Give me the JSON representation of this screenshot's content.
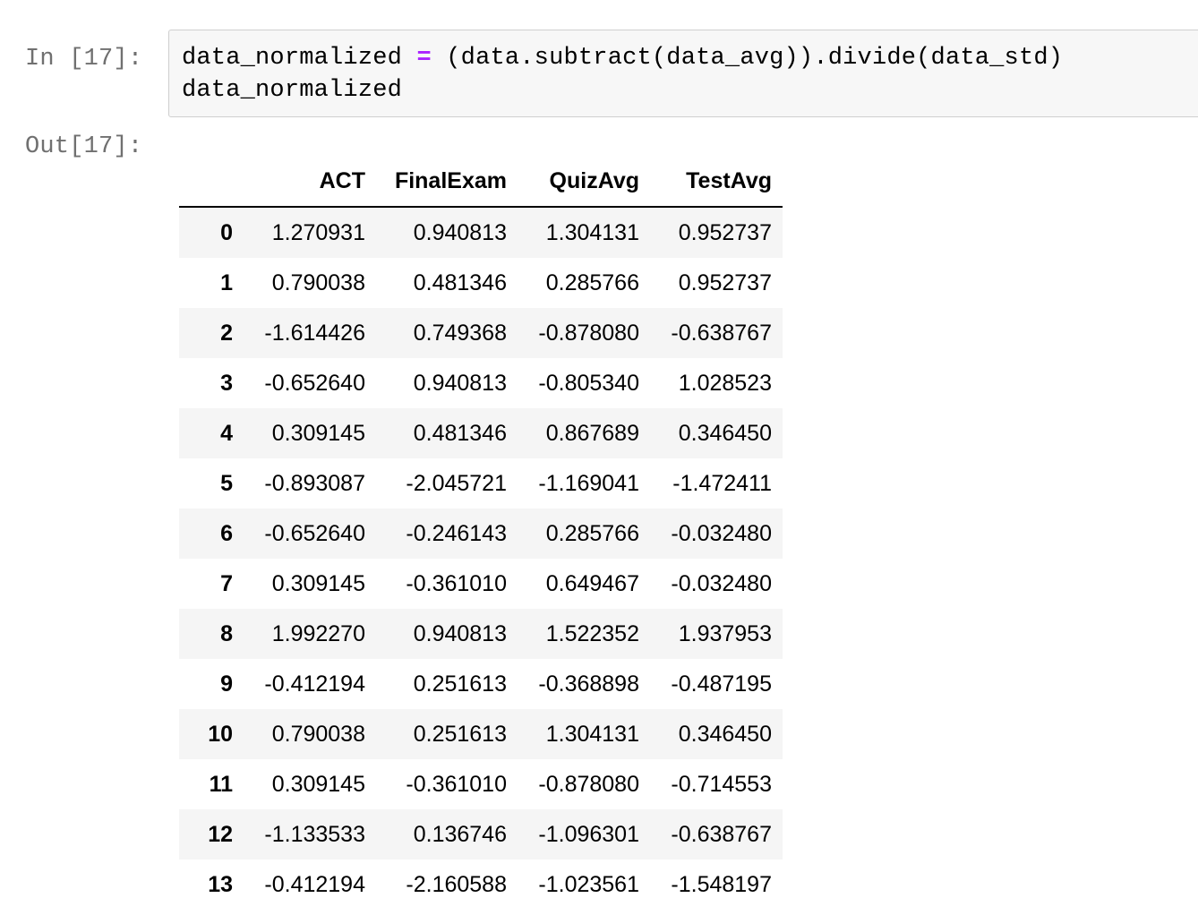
{
  "cells": {
    "input": {
      "prompt": "In [17]:",
      "code_line1_left": "data_normalized ",
      "code_line1_op": "=",
      "code_line1_right": " (data.subtract(data_avg)).divide(data_std)",
      "code_line2": "data_normalized"
    },
    "output": {
      "prompt": "Out[17]:"
    }
  },
  "table": {
    "columns": [
      "",
      "ACT",
      "FinalExam",
      "QuizAvg",
      "TestAvg"
    ],
    "rows": [
      {
        "index": "0",
        "ACT": "1.270931",
        "FinalExam": "0.940813",
        "QuizAvg": "1.304131",
        "TestAvg": "0.952737"
      },
      {
        "index": "1",
        "ACT": "0.790038",
        "FinalExam": "0.481346",
        "QuizAvg": "0.285766",
        "TestAvg": "0.952737"
      },
      {
        "index": "2",
        "ACT": "-1.614426",
        "FinalExam": "0.749368",
        "QuizAvg": "-0.878080",
        "TestAvg": "-0.638767"
      },
      {
        "index": "3",
        "ACT": "-0.652640",
        "FinalExam": "0.940813",
        "QuizAvg": "-0.805340",
        "TestAvg": "1.028523"
      },
      {
        "index": "4",
        "ACT": "0.309145",
        "FinalExam": "0.481346",
        "QuizAvg": "0.867689",
        "TestAvg": "0.346450"
      },
      {
        "index": "5",
        "ACT": "-0.893087",
        "FinalExam": "-2.045721",
        "QuizAvg": "-1.169041",
        "TestAvg": "-1.472411"
      },
      {
        "index": "6",
        "ACT": "-0.652640",
        "FinalExam": "-0.246143",
        "QuizAvg": "0.285766",
        "TestAvg": "-0.032480"
      },
      {
        "index": "7",
        "ACT": "0.309145",
        "FinalExam": "-0.361010",
        "QuizAvg": "0.649467",
        "TestAvg": "-0.032480"
      },
      {
        "index": "8",
        "ACT": "1.992270",
        "FinalExam": "0.940813",
        "QuizAvg": "1.522352",
        "TestAvg": "1.937953"
      },
      {
        "index": "9",
        "ACT": "-0.412194",
        "FinalExam": "0.251613",
        "QuizAvg": "-0.368898",
        "TestAvg": "-0.487195"
      },
      {
        "index": "10",
        "ACT": "0.790038",
        "FinalExam": "0.251613",
        "QuizAvg": "1.304131",
        "TestAvg": "0.346450"
      },
      {
        "index": "11",
        "ACT": "0.309145",
        "FinalExam": "-0.361010",
        "QuizAvg": "-0.878080",
        "TestAvg": "-0.714553"
      },
      {
        "index": "12",
        "ACT": "-1.133533",
        "FinalExam": "0.136746",
        "QuizAvg": "-1.096301",
        "TestAvg": "-0.638767"
      },
      {
        "index": "13",
        "ACT": "-0.412194",
        "FinalExam": "-2.160588",
        "QuizAvg": "-1.023561",
        "TestAvg": "-1.548197"
      }
    ]
  },
  "colors": {
    "prompt": "#707070",
    "code_bg": "#f7f7f7",
    "code_border": "#cfcfcf",
    "operator": "#aa22ff",
    "row_stripe": "#f5f5f5"
  }
}
